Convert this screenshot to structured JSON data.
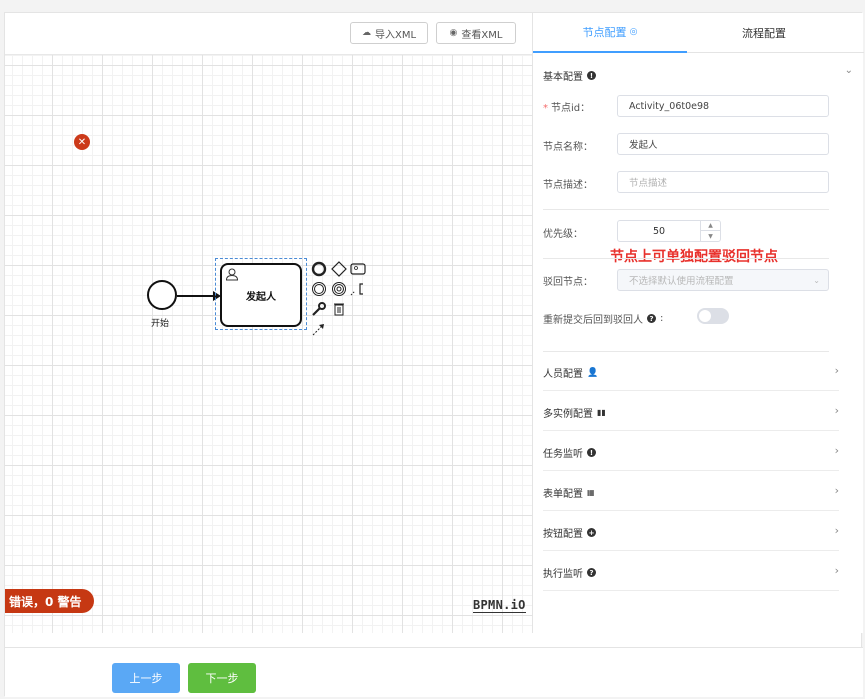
{
  "toolbar": {
    "import_label": "导入XML",
    "view_label": "查看XML"
  },
  "canvas": {
    "start_label": "开始",
    "task_label": "发起人",
    "error_pill": "错误，0 警告",
    "logo": "BPMN.iO"
  },
  "panel": {
    "tabs": [
      "节点配置",
      "流程配置"
    ],
    "basic_title": "基本配置",
    "fields": {
      "node_id_label": "节点id：",
      "node_id_value": "Activity_06t0e98",
      "node_name_label": "节点名称：",
      "node_name_value": "发起人",
      "node_desc_label": "节点描述：",
      "node_desc_placeholder": "节点描述",
      "priority_label": "优先级：",
      "priority_value": "50",
      "reject_label": "驳回节点：",
      "reject_placeholder": "不选择默认使用流程配置",
      "resubmit_label": "重新提交后回到驳回人"
    },
    "annotation": "节点上可单独配置驳回节点",
    "sections": [
      {
        "label": "人员配置",
        "icon": "user-icon"
      },
      {
        "label": "多实例配置",
        "icon": "bar-chart-icon"
      },
      {
        "label": "任务监听",
        "icon": "info-icon"
      },
      {
        "label": "表单配置",
        "icon": "form-icon"
      },
      {
        "label": "按钮配置",
        "icon": "plus-circle-icon"
      },
      {
        "label": "执行监听",
        "icon": "help-icon"
      }
    ]
  },
  "footer": {
    "prev_label": "上一步",
    "next_label": "下一步"
  },
  "colors": {
    "accent": "#409eff",
    "error": "#c63813",
    "next": "#5fbe3f",
    "prev": "#5aa8f5"
  }
}
